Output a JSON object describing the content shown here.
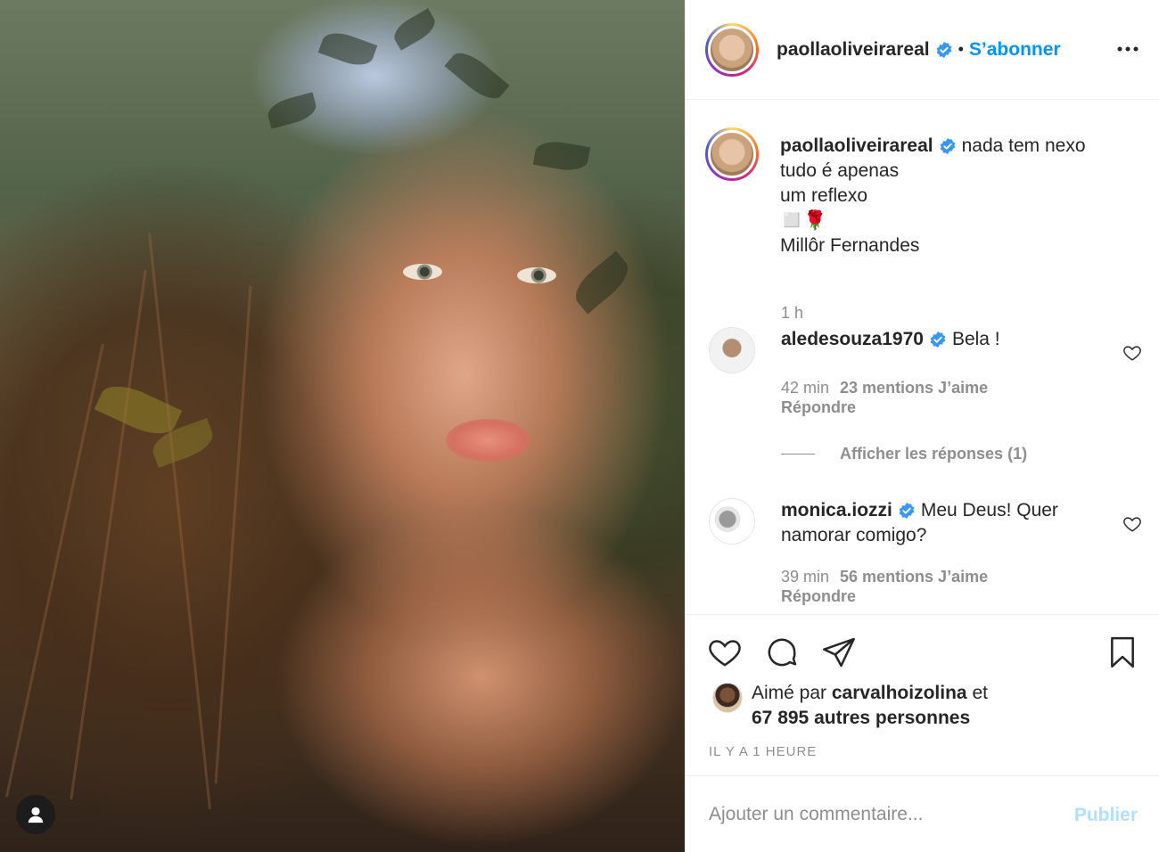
{
  "post": {
    "username": "paollaoliveirareal",
    "follow_label": "S’abonner",
    "separator": "•"
  },
  "caption": {
    "username": "paollaoliveirareal",
    "lines": [
      "nada tem nexo",
      "tudo é apenas",
      "um reflexo",
      "◻️🌹",
      "Millôr Fernandes"
    ],
    "time": "1 h"
  },
  "comments": [
    {
      "username": "aledesouza1970",
      "text": "Bela !",
      "time": "42 min",
      "likes": "23 mentions J’aime",
      "reply_label": "Répondre"
    },
    {
      "username": "monica.iozzi",
      "text": "Meu Deus! Quer namorar comigo?",
      "time": "39 min",
      "likes": "56 mentions J’aime",
      "reply_label": "Répondre"
    }
  ],
  "show_replies_label": "Afficher les réponses (1)",
  "likes": {
    "prefix": "Aimé par",
    "user": "carvalhoizolina",
    "conj": "et",
    "others": "67 895 autres personnes"
  },
  "timestamp": "IL Y A 1 HEURE",
  "add_comment": {
    "placeholder": "Ajouter un commentaire...",
    "publish_label": "Publier"
  },
  "colors": {
    "accent": "#0095f6",
    "muted": "#8e8e8e",
    "publish_disabled": "#b2dffc",
    "verified": "#3897f0"
  },
  "icons": [
    "verified-icon",
    "more-icon",
    "heart-icon",
    "comment-icon",
    "share-icon",
    "bookmark-icon",
    "user-icon"
  ]
}
